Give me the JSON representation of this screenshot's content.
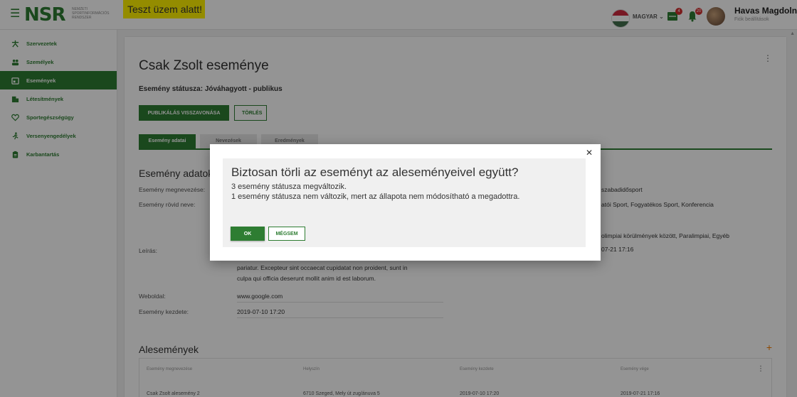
{
  "header": {
    "logo": "NSR",
    "logo_sub": [
      "NEMZETI",
      "SPORTINFORMÁCIÓS",
      "RENDSZER"
    ],
    "test_badge": "Teszt üzem alatt!",
    "language": "MAGYAR",
    "notification_counts": [
      "4",
      "20"
    ],
    "user_name": "Havas Magdolna",
    "user_sub": "Fiók beállítások"
  },
  "sidebar": {
    "items": [
      {
        "label": "Szervezetek",
        "icon": "organization-icon"
      },
      {
        "label": "Személyek",
        "icon": "people-icon"
      },
      {
        "label": "Események",
        "icon": "calendar-icon",
        "active": true
      },
      {
        "label": "Létesítmények",
        "icon": "building-icon"
      },
      {
        "label": "Sportegészségügy",
        "icon": "heart-icon"
      },
      {
        "label": "Versenyengedélyek",
        "icon": "runner-icon"
      },
      {
        "label": "Karbantartás",
        "icon": "clipboard-icon"
      }
    ]
  },
  "page": {
    "title": "Csak Zsolt eseménye",
    "status": "Esemény státusza: Jóváhagyott - publikus",
    "unpublish_button": "PUBLIKÁLÁS VISSZAVONÁSA",
    "delete_button": "TÖRLÉS",
    "tabs": [
      "Esemény adatai",
      "Nevezések",
      "Eredmények"
    ],
    "section_title": "Esemény adatok",
    "fields": {
      "name_label": "Esemény megnevezése:",
      "short_name_label": "Esemény rövid neve:",
      "description_label": "Leírás:",
      "website_label": "Weboldal:",
      "website_value": "www.google.com",
      "start_label": "Esemény kezdete:",
      "start_value": "2019-07-10 17:20"
    },
    "description_lines": [
      "pariatur. Excepteur sint occaecat cupidatat non proident, sunt in",
      "culpa qui officia deserunt mollit anim id est laborum."
    ],
    "right_values": [
      "szabadidősport",
      "atói Sport, Fogyatékos Sport, Konferencia",
      "olimpiai körülmények között, Paralimpiai, Egyéb",
      "07-21 17:16"
    ],
    "sub_events": {
      "title": "Alesemények",
      "columns": [
        "Esemény megnevezése",
        "Helyszín",
        "Esemény kezdete",
        "Esemény vége"
      ],
      "row": [
        "Csak Zsolt alesemény 2",
        "6710 Szeged, Mely út zug/ánuva 5",
        "2019-07-10 17:20",
        "2019-07-21 17:16"
      ]
    }
  },
  "dialog": {
    "title": "Biztosan törli az eseményt az aleseményeivel együtt?",
    "line1": "3 esemény státusza megváltozik.",
    "line2": "1 esemény státusza nem változik, mert az állapota nem módosítható a megadottra.",
    "ok": "OK",
    "cancel": "MÉGSEM"
  },
  "colors": {
    "primary": "#2e7d32",
    "accent": "#f57c00",
    "test_badge": "#fff200",
    "badge": "#d32f2f"
  }
}
